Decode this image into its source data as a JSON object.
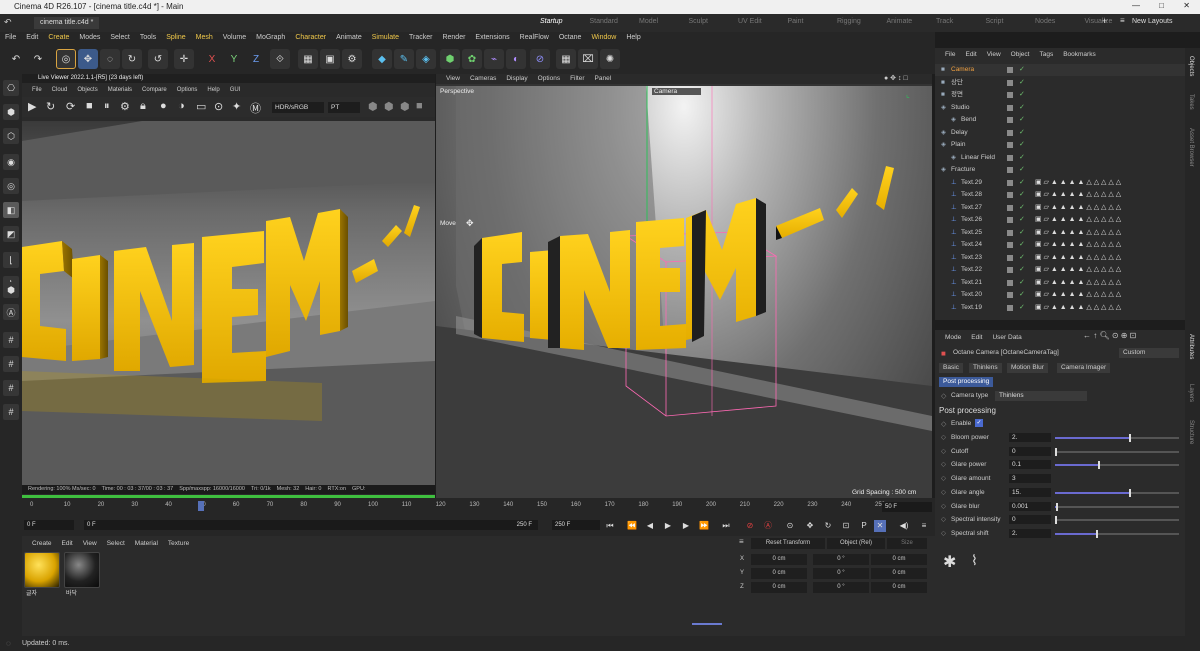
{
  "window": {
    "title": "Cinema 4D R26.107 - [cinema title.c4d *] - Main"
  },
  "tabs": {
    "file_tab": "cinema title.c4d *",
    "layouts": [
      "Startup",
      "Standard",
      "Model",
      "Sculpt",
      "UV Edit",
      "Paint",
      "Rigging",
      "Animate",
      "Track",
      "Script",
      "Nodes",
      "Visualize"
    ],
    "new_layouts": "New Layouts"
  },
  "menu": [
    "File",
    "Edit",
    "Create",
    "Modes",
    "Select",
    "Tools",
    "Spline",
    "Mesh",
    "Volume",
    "MoGraph",
    "Character",
    "Animate",
    "Simulate",
    "Tracker",
    "Render",
    "Extensions",
    "RealFlow",
    "Octane",
    "Window",
    "Help"
  ],
  "toolbar_axes": {
    "x": "X",
    "y": "Y",
    "z": "Z"
  },
  "live_viewer": {
    "title": "Live Viewer 2022.1.1-[R5] (23 days left)",
    "menu": [
      "File",
      "Cloud",
      "Objects",
      "Materials",
      "Compare",
      "Options",
      "Help",
      "GUI"
    ],
    "colorspace": "HDR/sRGB",
    "mode": "PT",
    "status": {
      "rendering": "Rendering: 100% Ms/sec: 0",
      "time": "Time: 00 : 03 : 37/00 : 03 : 37",
      "spp": "Spp/maxspp: 16000/16000",
      "tri": "Tri: 0/1k",
      "mesh": "Mesh: 32",
      "hair": "Hair: 0",
      "rtx": "RTX:on",
      "gpu": "GPU:"
    }
  },
  "viewport": {
    "menu": [
      "View",
      "Cameras",
      "Display",
      "Options",
      "Filter",
      "Panel"
    ],
    "label": "Perspective",
    "camera": "Camera",
    "move": "Move",
    "grid_spacing": "Grid Spacing : 500 cm",
    "scene_text": "CINEM"
  },
  "timeline": {
    "ticks": [
      "0",
      "10",
      "20",
      "30",
      "40",
      "50",
      "60",
      "70",
      "80",
      "90",
      "100",
      "110",
      "120",
      "130",
      "140",
      "150",
      "160",
      "170",
      "180",
      "190",
      "200",
      "210",
      "220",
      "230",
      "240",
      "250"
    ],
    "current_frame": "50 F",
    "start": "0 F",
    "min": "0 F",
    "max": "250 F",
    "end": "250 F"
  },
  "materials": {
    "menu": [
      "Create",
      "Edit",
      "View",
      "Select",
      "Material",
      "Texture"
    ],
    "items": [
      {
        "name": "글자"
      },
      {
        "name": "바닥"
      }
    ]
  },
  "coordinates": {
    "reset": "Reset Transform",
    "mode": "Object (Rel)",
    "size": "Size",
    "rows": [
      {
        "axis": "X",
        "pos": "0 cm",
        "rot": "0 °",
        "size": "0 cm"
      },
      {
        "axis": "Y",
        "pos": "0 cm",
        "rot": "0 °",
        "size": "0 cm"
      },
      {
        "axis": "Z",
        "pos": "0 cm",
        "rot": "0 °",
        "size": "0 cm"
      }
    ]
  },
  "objects": {
    "menu": [
      "File",
      "Edit",
      "View",
      "Object",
      "Tags",
      "Bookmarks"
    ],
    "items": [
      {
        "name": "Camera",
        "indent": 0
      },
      {
        "name": "상단",
        "indent": 0
      },
      {
        "name": "정면",
        "indent": 0
      },
      {
        "name": "Studio",
        "indent": 0
      },
      {
        "name": "Bend",
        "indent": 1
      },
      {
        "name": "Delay",
        "indent": 0
      },
      {
        "name": "Plain",
        "indent": 0
      },
      {
        "name": "Linear Field",
        "indent": 1
      },
      {
        "name": "Fracture",
        "indent": 0
      },
      {
        "name": "Text.29",
        "indent": 1
      },
      {
        "name": "Text.28",
        "indent": 1
      },
      {
        "name": "Text.27",
        "indent": 1
      },
      {
        "name": "Text.26",
        "indent": 1
      },
      {
        "name": "Text.25",
        "indent": 1
      },
      {
        "name": "Text.24",
        "indent": 1
      },
      {
        "name": "Text.23",
        "indent": 1
      },
      {
        "name": "Text.22",
        "indent": 1
      },
      {
        "name": "Text.21",
        "indent": 1
      },
      {
        "name": "Text.20",
        "indent": 1
      },
      {
        "name": "Text.19",
        "indent": 1
      }
    ]
  },
  "attributes": {
    "menu": [
      "Mode",
      "Edit",
      "User Data"
    ],
    "tag_title": "Octane Camera [OctaneCameraTag]",
    "preset": "Custom",
    "tabs": [
      "Basic",
      "Thinlens",
      "Motion Blur",
      "Camera Imager"
    ],
    "active_tab": "Post processing",
    "camera_type_label": "Camera type",
    "camera_type": "Thinlens",
    "section": "Post processing",
    "enable_label": "Enable",
    "params": [
      {
        "label": "Bloom power",
        "value": "2.",
        "fraction": 0.6
      },
      {
        "label": "Cutoff",
        "value": "0",
        "fraction": 0.0
      },
      {
        "label": "Glare power",
        "value": "0.1",
        "fraction": 0.35
      },
      {
        "label": "Glare amount",
        "value": "3",
        "fraction": null
      },
      {
        "label": "Glare angle",
        "value": "15.",
        "fraction": 0.6
      },
      {
        "label": "Glare blur",
        "value": "0.001",
        "fraction": 0.01
      },
      {
        "label": "Spectral intensity",
        "value": "0",
        "fraction": 0.0
      },
      {
        "label": "Spectral shift",
        "value": "2.",
        "fraction": 0.33
      }
    ]
  },
  "side_tabs": [
    "Objects",
    "Takes",
    "Asset Browser",
    "Attributes",
    "Layers",
    "Structure"
  ],
  "status": {
    "text": "Updated: 0 ms."
  }
}
